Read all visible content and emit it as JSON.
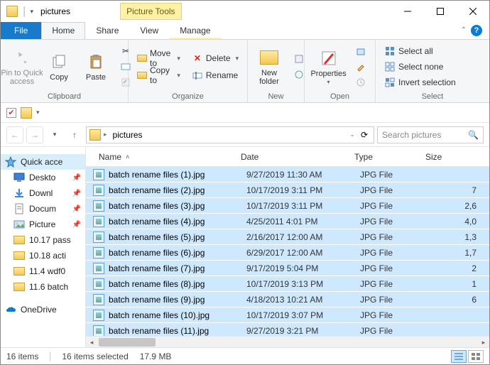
{
  "window": {
    "title": "pictures",
    "picture_tools": "Picture Tools"
  },
  "tabs": {
    "file": "File",
    "home": "Home",
    "share": "Share",
    "view": "View",
    "manage": "Manage"
  },
  "ribbon": {
    "clipboard": {
      "label": "Clipboard",
      "pin": "Pin to Quick\naccess",
      "copy": "Copy",
      "paste": "Paste"
    },
    "organize": {
      "label": "Organize",
      "moveto": "Move to",
      "copyto": "Copy to",
      "delete": "Delete",
      "rename": "Rename"
    },
    "new": {
      "label": "New",
      "newfolder": "New\nfolder"
    },
    "open": {
      "label": "Open",
      "properties": "Properties"
    },
    "select": {
      "label": "Select",
      "all": "Select all",
      "none": "Select none",
      "invert": "Invert selection"
    }
  },
  "address": {
    "crumb": "pictures"
  },
  "search": {
    "placeholder": "Search pictures"
  },
  "sidebar": {
    "items": [
      {
        "label": "Quick acce",
        "icon": "star",
        "selected": true
      },
      {
        "label": "Deskto",
        "icon": "desktop",
        "pin": true
      },
      {
        "label": "Downl",
        "icon": "download",
        "pin": true
      },
      {
        "label": "Docum",
        "icon": "document",
        "pin": true
      },
      {
        "label": "Picture",
        "icon": "pictures",
        "pin": true
      },
      {
        "label": "10.17 pass",
        "icon": "folder"
      },
      {
        "label": "10.18 acti",
        "icon": "folder"
      },
      {
        "label": "11.4 wdf0",
        "icon": "folder"
      },
      {
        "label": "11.6 batch",
        "icon": "folder"
      },
      {
        "label": "OneDrive",
        "icon": "onedrive"
      }
    ]
  },
  "columns": {
    "name": "Name",
    "date": "Date",
    "type": "Type",
    "size": "Size"
  },
  "files": [
    {
      "name": "batch rename files (1).jpg",
      "date": "9/27/2019 11:30 AM",
      "type": "JPG File",
      "size": ""
    },
    {
      "name": "batch rename files (2).jpg",
      "date": "10/17/2019 3:11 PM",
      "type": "JPG File",
      "size": "7"
    },
    {
      "name": "batch rename files (3).jpg",
      "date": "10/17/2019 3:11 PM",
      "type": "JPG File",
      "size": "2,6"
    },
    {
      "name": "batch rename files (4).jpg",
      "date": "4/25/2011 4:01 PM",
      "type": "JPG File",
      "size": "4,0"
    },
    {
      "name": "batch rename files (5).jpg",
      "date": "2/16/2017 12:00 AM",
      "type": "JPG File",
      "size": "1,3"
    },
    {
      "name": "batch rename files (6).jpg",
      "date": "6/29/2017 12:00 AM",
      "type": "JPG File",
      "size": "1,7"
    },
    {
      "name": "batch rename files (7).jpg",
      "date": "9/17/2019 5:04 PM",
      "type": "JPG File",
      "size": "2"
    },
    {
      "name": "batch rename files (8).jpg",
      "date": "10/17/2019 3:13 PM",
      "type": "JPG File",
      "size": "1"
    },
    {
      "name": "batch rename files (9).jpg",
      "date": "4/18/2013 10:21 AM",
      "type": "JPG File",
      "size": "6"
    },
    {
      "name": "batch rename files (10).jpg",
      "date": "10/17/2019 3:07 PM",
      "type": "JPG File",
      "size": ""
    },
    {
      "name": "batch rename files (11).jpg",
      "date": "9/27/2019 3:21 PM",
      "type": "JPG File",
      "size": ""
    }
  ],
  "status": {
    "count": "16 items",
    "selected": "16 items selected",
    "size": "17.9 MB"
  }
}
